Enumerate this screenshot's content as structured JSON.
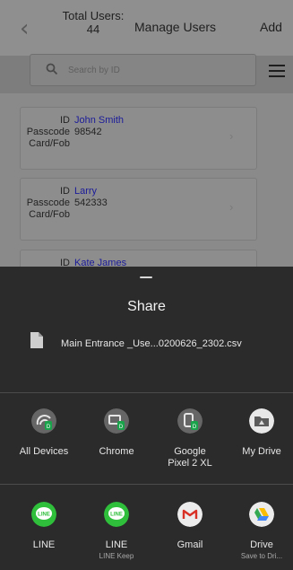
{
  "header": {
    "total_label": "Total Users:",
    "total_count": "44",
    "title": "Manage Users",
    "add_label": "Add"
  },
  "search": {
    "placeholder": "Search by ID"
  },
  "users": [
    {
      "id_label": "ID",
      "name": "John Smith",
      "passcode_label": "Passcode",
      "passcode": "98542",
      "card_label": "Card/Fob"
    },
    {
      "id_label": "ID",
      "name": "Larry",
      "passcode_label": "Passcode",
      "passcode": "542333",
      "card_label": "Card/Fob"
    },
    {
      "id_label": "ID",
      "name": "Kate James"
    }
  ],
  "share": {
    "title": "Share",
    "file_name": "Main Entrance _Use...0200626_2302.csv",
    "targets_row1": [
      {
        "label": "All Devices",
        "icon": "device-share-icon"
      },
      {
        "label": "Chrome",
        "icon": "chrome-devices-icon"
      },
      {
        "label": "Google Pixel 2 XL",
        "line1": "Google",
        "line2": "Pixel 2 XL",
        "icon": "phone-share-icon"
      },
      {
        "label": "My Drive",
        "icon": "drive-folder-icon"
      }
    ],
    "targets_row2": [
      {
        "label": "LINE",
        "icon": "line-icon"
      },
      {
        "label": "LINE",
        "sub": "LINE Keep",
        "icon": "line-keep-icon"
      },
      {
        "label": "Gmail",
        "icon": "gmail-icon"
      },
      {
        "label": "Drive",
        "sub": "Save to Dri...",
        "icon": "google-drive-icon"
      }
    ]
  },
  "colors": {
    "sheet_bg": "#2b2b2b",
    "line_green": "#2fbf3b",
    "name_blue": "#1b1b9a"
  }
}
